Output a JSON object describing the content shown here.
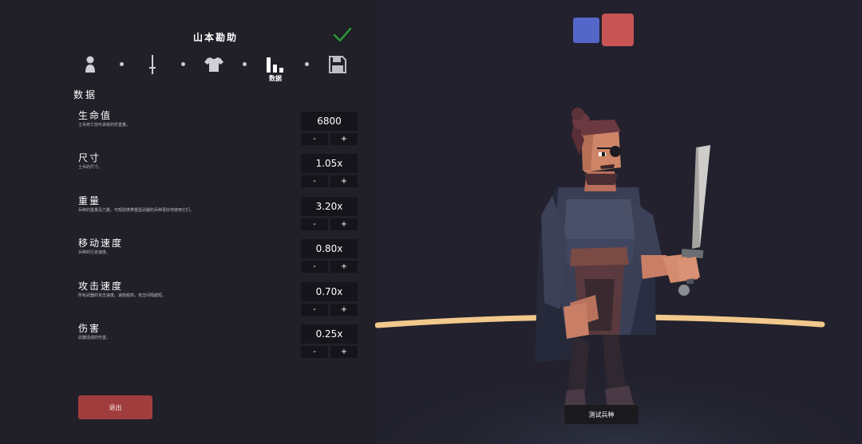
{
  "unit": {
    "name": "山本勘助"
  },
  "tabs": {
    "active_label": "数据"
  },
  "section": {
    "title": "数据"
  },
  "stats": [
    {
      "label": "生命值",
      "desc": "士兵死亡前可承受的伤害量。",
      "value": "6800",
      "minus": "-",
      "plus": "+"
    },
    {
      "label": "尺寸",
      "desc": "士兵的尺寸。",
      "value": "1.05x",
      "minus": "-",
      "plus": "+"
    },
    {
      "label": "重量",
      "desc": "兵种的重量及力量。可帮助携带重型武器的兵种更好地使用它们。",
      "value": "3.20x",
      "minus": "-",
      "plus": "+"
    },
    {
      "label": "移动速度",
      "desc": "兵种的行走速度。",
      "value": "0.80x",
      "minus": "-",
      "plus": "+"
    },
    {
      "label": "攻击速度",
      "desc": "所有武器的攻击速度。速度越高，攻击间隔越短。",
      "value": "0.70x",
      "minus": "-",
      "plus": "+"
    },
    {
      "label": "伤害",
      "desc": "武器造成的伤害。",
      "value": "0.25x",
      "minus": "-",
      "plus": "+"
    }
  ],
  "exit_label": "退出",
  "test_label": "测试兵种",
  "icons": [
    "person-icon",
    "sword-icon",
    "shirt-icon",
    "stats-icon",
    "save-icon",
    "check-icon"
  ],
  "colors": {
    "team_blue": "#5466c7",
    "team_red": "#c85454",
    "exit_button": "#a23d3d",
    "check": "#2e8a3e"
  }
}
